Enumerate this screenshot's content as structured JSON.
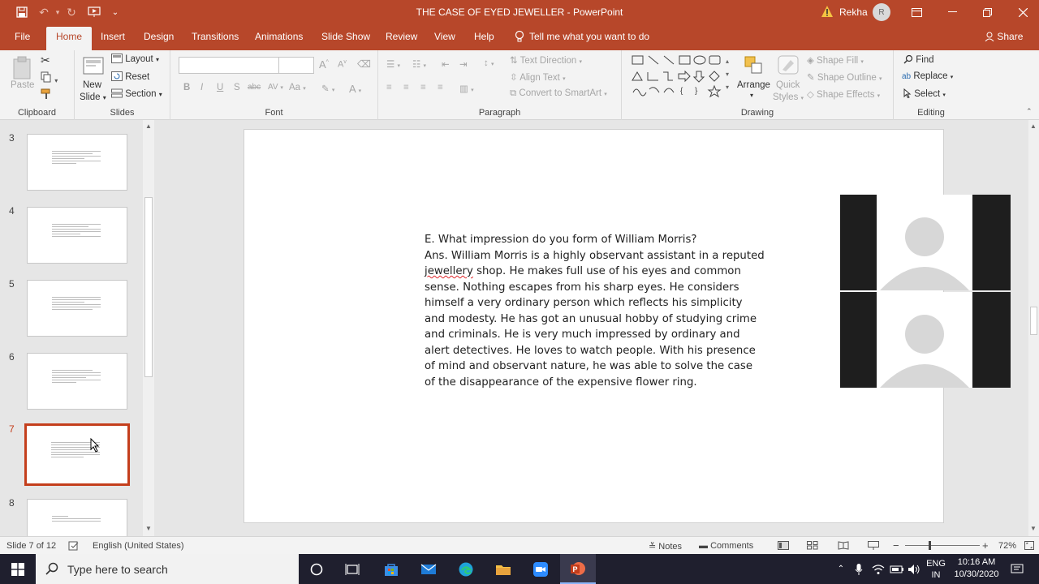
{
  "window": {
    "title": "THE CASE OF EYED JEWELLER  -  PowerPoint",
    "user_name": "Rekha",
    "user_initial": "R"
  },
  "tabs": [
    "File",
    "Home",
    "Insert",
    "Design",
    "Transitions",
    "Animations",
    "Slide Show",
    "Review",
    "View",
    "Help"
  ],
  "tell_me": "Tell me what you want to do",
  "share_label": "Share",
  "ribbon": {
    "clipboard": {
      "label": "Clipboard",
      "paste": "Paste"
    },
    "slides": {
      "label": "Slides",
      "new_slide_line1": "New",
      "new_slide_line2": "Slide",
      "layout": "Layout",
      "reset": "Reset",
      "section": "Section"
    },
    "font": {
      "label": "Font",
      "bold": "B",
      "italic": "I",
      "underline": "U",
      "shadow": "S",
      "strike": "abc",
      "spacing": "AV",
      "case": "Aa",
      "grow": "A",
      "shrink": "A",
      "color": "A"
    },
    "paragraph": {
      "label": "Paragraph",
      "text_direction": "Text Direction",
      "align_text": "Align Text",
      "convert_smartart": "Convert to SmartArt"
    },
    "drawing": {
      "label": "Drawing",
      "arrange": "Arrange",
      "quick_styles_line1": "Quick",
      "quick_styles_line2": "Styles",
      "shape_fill": "Shape Fill",
      "shape_outline": "Shape Outline",
      "shape_effects": "Shape Effects"
    },
    "editing": {
      "label": "Editing",
      "find": "Find",
      "replace": "Replace",
      "select": "Select"
    }
  },
  "slide_thumbs": [
    {
      "number": "3"
    },
    {
      "number": "4"
    },
    {
      "number": "5"
    },
    {
      "number": "6"
    },
    {
      "number": "7"
    },
    {
      "number": "8"
    }
  ],
  "slide": {
    "question": "E. What impression do you form of William Morris?",
    "answer_before": "Ans. William Morris is a highly observant assistant in a reputed ",
    "answer_spell": "jewellery",
    "answer_after": " shop. He makes full use of his eyes and common sense. Nothing escapes from his sharp eyes. He considers himself a very ordinary person which reflects his simplicity and modesty. He has got an unusual hobby of studying crime and criminals. He is very much impressed by ordinary and alert detectives. He loves to watch people. With his presence of mind and observant nature, he was able to solve the case of the disappearance of the expensive flower ring."
  },
  "status": {
    "slide_of": "Slide 7 of 12",
    "language": "English (United States)",
    "notes": "Notes",
    "comments": "Comments",
    "zoom": "72%"
  },
  "taskbar": {
    "search_placeholder": "Type here to search",
    "lang_line1": "ENG",
    "lang_line2": "IN",
    "time": "10:16 AM",
    "date": "10/30/2020"
  }
}
